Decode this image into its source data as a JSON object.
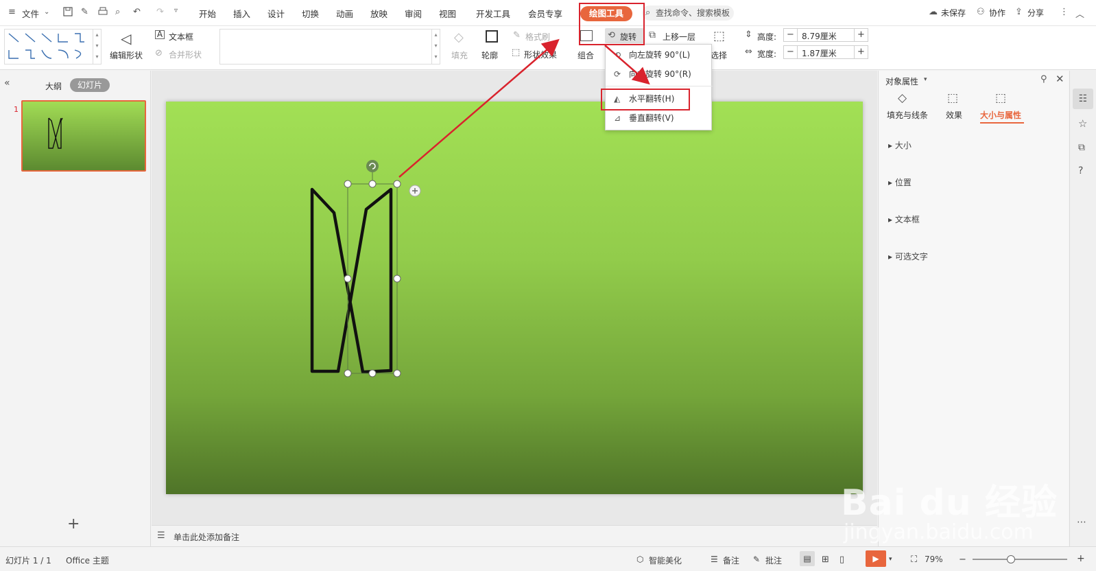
{
  "menubar": {
    "file": "文件",
    "tabs": [
      "开始",
      "插入",
      "设计",
      "切换",
      "动画",
      "放映",
      "审阅",
      "视图",
      "开发工具",
      "会员专享"
    ],
    "active_tab": "绘图工具",
    "search_placeholder": "查找命令、搜索模板",
    "unsaved": "未保存",
    "collaborate": "协作",
    "share": "分享"
  },
  "ribbon": {
    "edit_shape": "编辑形状",
    "textbox": "文本框",
    "merge_shape": "合并形状",
    "fill": "填充",
    "outline": "轮廓",
    "format_painter": "格式刷",
    "shape_effect": "形状效果",
    "group": "组合",
    "rotate": "旋转",
    "bring_forward": "上移一层",
    "select": "选择",
    "height_label": "高度:",
    "height_value": "8.79厘米",
    "width_label": "宽度:",
    "width_value": "1.87厘米",
    "line_colors": [
      "#222222",
      "#5b9bd5",
      "#4bacc6",
      "#4aa3b8",
      "#f2c14e",
      "#e07b7b"
    ]
  },
  "rotate_menu": {
    "items": [
      "向左旋转 90°(L)",
      "向右旋转 90°(R)",
      "水平翻转(H)",
      "垂直翻转(V)"
    ],
    "highlighted": "水平翻转(H)"
  },
  "left_panel": {
    "outline_tab": "大纲",
    "slides_tab": "幻灯片",
    "slide_number": "1",
    "add_slide": "+"
  },
  "notes": {
    "placeholder": "单击此处添加备注"
  },
  "right_panel": {
    "title": "对象属性",
    "tabs": [
      "填充与线条",
      "效果",
      "大小与属性"
    ],
    "active_tab": "大小与属性",
    "sections": [
      "大小",
      "位置",
      "文本框",
      "可选文字"
    ]
  },
  "statusbar": {
    "slide_info": "幻灯片 1 / 1",
    "theme": "Office 主题",
    "smart_beautify": "智能美化",
    "notes": "备注",
    "comments": "批注",
    "zoom": "79%"
  },
  "colors": {
    "accent": "#e8663d",
    "highlight": "#d9232d",
    "slide_top": "#a2e055",
    "slide_bottom": "#4f7428"
  },
  "watermark": {
    "brand": "Bai du 经验",
    "url": "jingyan.baidu.com"
  }
}
